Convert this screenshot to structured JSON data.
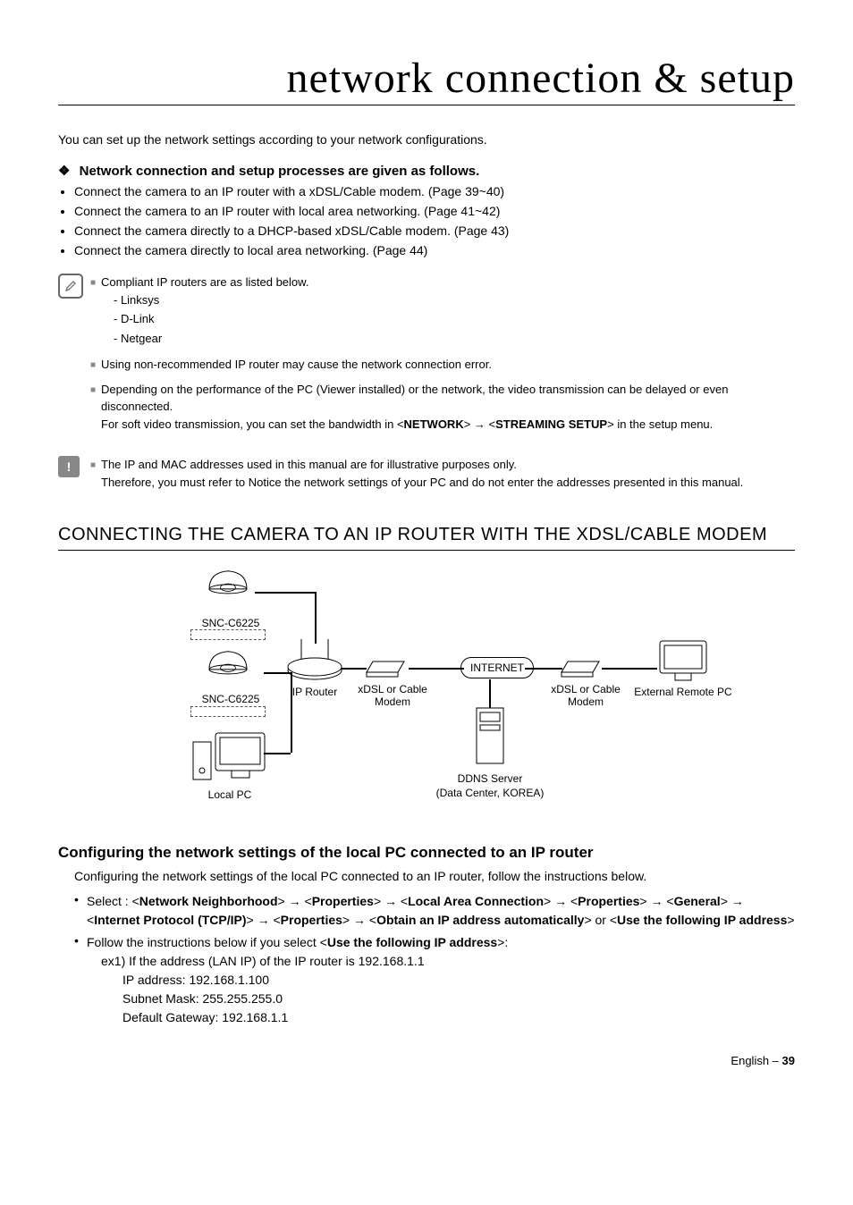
{
  "title": "network connection & setup",
  "intro": "You can set up the network settings according to your network configurations.",
  "subheading": "Network connection and setup processes are given as follows.",
  "mainBullets": [
    "Connect the camera to an IP router with a xDSL/Cable modem. (Page 39~40)",
    "Connect the camera to an IP router with local area networking. (Page 41~42)",
    "Connect the camera directly to a DHCP-based xDSL/Cable modem. (Page 43)",
    "Connect the camera directly to local area networking. (Page 44)"
  ],
  "note1": {
    "item1": "Compliant IP routers are as listed below.",
    "routers": [
      "- Linksys",
      "- D-Link",
      "- Netgear"
    ],
    "item2": "Using non-recommended IP router may cause the network connection error.",
    "item3a": "Depending on the performance of the PC (Viewer installed) or the network, the video transmission can be delayed or even disconnected.",
    "item3b_prefix": "For soft video transmission, you can set the bandwidth in <",
    "item3b_net": "NETWORK",
    "item3b_mid": "> → <",
    "item3b_stream": "STREAMING SETUP",
    "item3b_suffix": "> in the setup menu."
  },
  "note2": {
    "line1": "The IP and MAC addresses used in this manual are for illustrative purposes only.",
    "line2": "Therefore, you must refer to Notice the network settings of your PC and do not enter the addresses presented in this manual."
  },
  "sectionHeading": "CONNECTING THE CAMERA TO AN IP ROUTER WITH THE XDSL/CABLE MODEM",
  "diagram": {
    "cam1": "SNC-C6225",
    "cam2": "SNC-C6225",
    "localPC": "Local PC",
    "ipRouter": "IP Router",
    "modem1": "xDSL or Cable Modem",
    "internet": "INTERNET",
    "modem2": "xDSL or Cable Modem",
    "remotePC": "External Remote PC",
    "ddns": "DDNS Server",
    "ddnsSub": "(Data Center, KOREA)"
  },
  "subSectionHeading": "Configuring the network settings of the local PC connected to an IP router",
  "configIntro": "Configuring the network settings of the local PC connected to an IP router, follow the instructions below.",
  "selectPath": {
    "prefix": "Select : <",
    "p1": "Network Neighborhood",
    "p2": "Properties",
    "p3": "Local Area Connection",
    "p4": "Properties",
    "p5": "General",
    "p6": "Internet Protocol (TCP/IP)",
    "p7": "Properties",
    "p8": "Obtain an IP address automatically",
    "or": "> or",
    "p9": "Use the following IP address",
    "arrow": "> → <",
    "close": ">"
  },
  "followInstr": {
    "prefix": "Follow the instructions below if you select <",
    "bold": "Use the following IP address",
    "suffix": ">:"
  },
  "ex1": {
    "header": "ex1) If the address (LAN IP) of the IP router is 192.168.1.1",
    "ip": "IP address: 192.168.1.100",
    "mask": "Subnet Mask: 255.255.255.0",
    "gw": "Default Gateway: 192.168.1.1"
  },
  "footer": {
    "lang": "English –",
    "page": "39"
  }
}
